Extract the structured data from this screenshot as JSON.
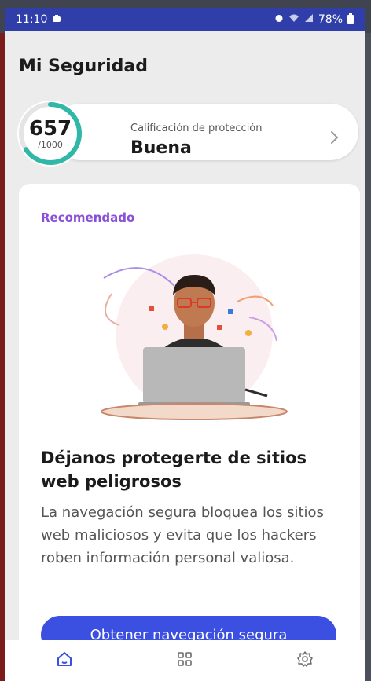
{
  "status_bar": {
    "time": "11:10",
    "battery": "78%",
    "left_icon": "notification-icon",
    "right_icons": [
      "alarm-icon",
      "wifi-icon",
      "signal-icon",
      "battery-icon"
    ]
  },
  "page": {
    "title": "Mi Seguridad"
  },
  "score": {
    "value": "657",
    "max": "/1000",
    "fraction": 0.657,
    "label": "Calificación de protección",
    "status": "Buena",
    "ring_color": "#2fb8a8"
  },
  "recommendation": {
    "badge": "Recomendado",
    "heading": "Déjanos protegerte de sitios web peligrosos",
    "body": "La navegación segura bloquea los sitios web maliciosos y evita que los hackers roben información personal valiosa.",
    "button_label": "Obtener navegación segura",
    "accent_color": "#8a4fd8",
    "button_color": "#3b4fe0"
  },
  "bottom_nav": {
    "items": [
      {
        "icon": "home-icon",
        "active": true
      },
      {
        "icon": "grid-icon",
        "active": false
      },
      {
        "icon": "gear-icon",
        "active": false
      }
    ]
  }
}
